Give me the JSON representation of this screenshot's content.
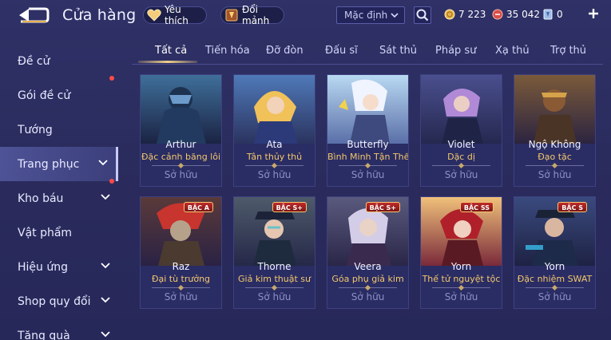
{
  "header": {
    "title": "Cửa hàng",
    "favorite_label": "Yêu thích",
    "exchange_label": "Đổi mảnh",
    "sort_value": "Mặc định",
    "gold": "7 223",
    "vouchers": "35 042",
    "quan_huy": "0"
  },
  "sidebar": {
    "items": [
      {
        "label": "Đề cử"
      },
      {
        "label": "Gói đề cử"
      },
      {
        "label": "Tướng"
      },
      {
        "label": "Trang phục"
      },
      {
        "label": "Kho báu"
      },
      {
        "label": "Vật phẩm"
      },
      {
        "label": "Hiệu ứng"
      },
      {
        "label": "Shop quy đổi"
      },
      {
        "label": "Tăng quà"
      }
    ]
  },
  "tabs": [
    "Tất cả",
    "Tiến hóa",
    "Đỡ đòn",
    "Đấu sĩ",
    "Sát thủ",
    "Pháp sư",
    "Xạ thủ",
    "Trợ thủ"
  ],
  "cards": [
    {
      "name": "Arthur",
      "skin": "Đặc cảnh băng lôi",
      "status": "Sở hữu",
      "badge": ""
    },
    {
      "name": "Ata",
      "skin": "Tân thủy thủ",
      "status": "Sở hữu",
      "badge": ""
    },
    {
      "name": "Butterfly",
      "skin": "Bình Minh Tận Thế",
      "status": "Sở hữu",
      "badge": ""
    },
    {
      "name": "Violet",
      "skin": "Dặc dị",
      "status": "Sở hữu",
      "badge": ""
    },
    {
      "name": "Ngộ Không",
      "skin": "Đạo tặc",
      "status": "Sở hữu",
      "badge": ""
    },
    {
      "name": "Raz",
      "skin": "Đại tù trưởng",
      "status": "Sở hữu",
      "badge": "BẬC A"
    },
    {
      "name": "Thorne",
      "skin": "Giả kim thuật sư",
      "status": "Sở hữu",
      "badge": "BẬC S+"
    },
    {
      "name": "Veera",
      "skin": "Góa phụ giả kim",
      "status": "Sở hữu",
      "badge": "BẬC S+"
    },
    {
      "name": "Yorn",
      "skin": "Thế tử nguyệt tộc",
      "status": "Sở hữu",
      "badge": "BẬC SS"
    },
    {
      "name": "Yorn",
      "skin": "Đặc nhiệm SWAT",
      "status": "Sở hữu",
      "badge": "BẬC S"
    }
  ],
  "colors": {
    "accent_gold": "#f2c86b",
    "badge_red": "#c02a2a",
    "notify_dot": "#ff4a4a"
  },
  "icons": [
    "back-icon",
    "heart-icon",
    "shard-icon",
    "chevron-down-icon",
    "search-icon",
    "gold-coin-icon",
    "voucher-icon",
    "quan-huy-icon",
    "plus-icon"
  ]
}
